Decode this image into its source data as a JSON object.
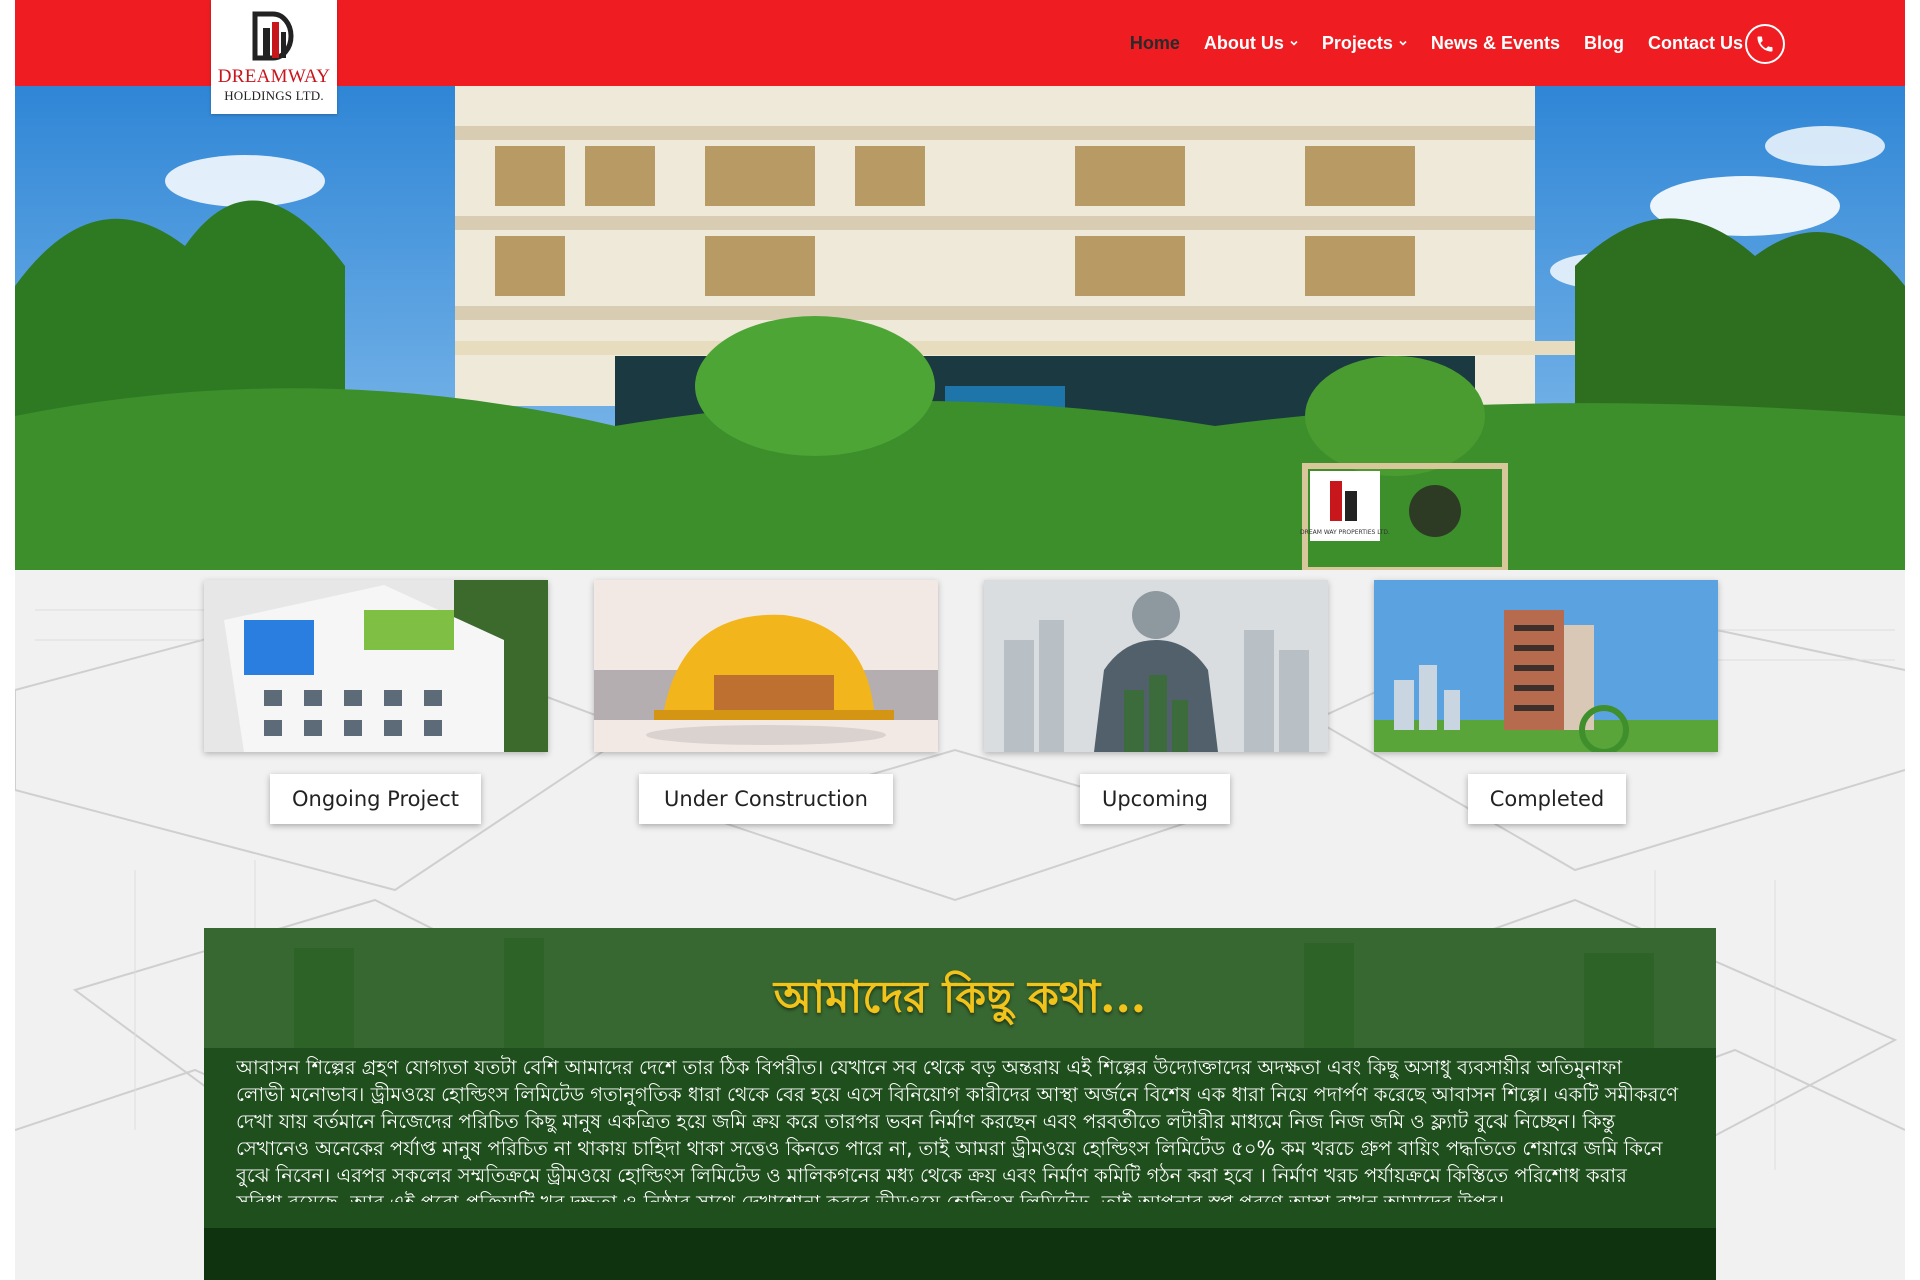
{
  "brand": {
    "name_line1": "DREAMWAY",
    "name_line2": "HOLDINGS LTD.",
    "primary_color": "#ef1d22"
  },
  "nav": {
    "items": [
      {
        "label": "Home",
        "active": true,
        "has_dropdown": false
      },
      {
        "label": "About Us",
        "active": false,
        "has_dropdown": true
      },
      {
        "label": "Projects",
        "active": false,
        "has_dropdown": true
      },
      {
        "label": "News & Events",
        "active": false,
        "has_dropdown": false
      },
      {
        "label": "Blog",
        "active": false,
        "has_dropdown": false
      },
      {
        "label": "Contact Us",
        "active": false,
        "has_dropdown": false
      }
    ],
    "phone_icon": "phone-icon"
  },
  "hero": {
    "image": "building-render",
    "sign": "DREAM WAY PROPERTIES LTD."
  },
  "categories": [
    {
      "label": "Ongoing Project",
      "image": "rooftop-pool-building"
    },
    {
      "label": "Under Construction",
      "image": "hard-hat-city-sunset"
    },
    {
      "label": "Upcoming",
      "image": "engineer-city-double-exposure"
    },
    {
      "label": "Completed",
      "image": "tower-with-city-skyline"
    }
  ],
  "about": {
    "title": "আমাদের কিছু কথা...",
    "paragraph_lines": [
      "আবাসন শিল্পের গ্রহণ যোগ্যতা যতটা বেশি আমাদের দেশে তার ঠিক বিপরীত। যেখানে সব থেকে বড় অন্তরায় এই শিল্পের উদ্যোক্তাদের অদক্ষতা এবং কিছু অসাধু ব্যবসায়ীর অতিমুনাফা",
      "লোভী মনোভাব। ড্রীমওয়ে হোল্ডিংস লিমিটেড গতানুগতিক ধারা থেকে বের হয়ে এসে বিনিয়োগ কারীদের আস্থা অর্জনে বিশেষ এক ধারা নিয়ে পদার্পণ করেছে আবাসন শিল্পে। একটি সমীকরণে",
      "দেখা যায় বর্তমানে নিজেদের পরিচিত কিছু মানুষ একত্রিত হয়ে জমি ক্রয় করে তারপর ভবন নির্মাণ করছেন এবং পরবর্তীতে লটারীর মাধ্যমে নিজ নিজ জমি ও ফ্ল্যাট বুঝে নিচ্ছেন। কিন্তু",
      "সেখানেও অনেকের পর্যাপ্ত মানুষ পরিচিত না থাকায় চাহিদা থাকা সত্তেও কিনতে পারে না, তাই আমরা ড্রীমওয়ে হোল্ডিংস লিমিটেড ৫০% কম খরচে গ্রুপ বায়িং পদ্ধতিতে শেয়ারে জমি কিনে",
      "বুঝে নিবেন। এরপর সকলের সম্মতিক্রমে ড্রীমওয়ে হোল্ডিংস লিমিটেড ও মালিকগনের মধ্য থেকে ক্রয় এবং নির্মাণ কমিটি গঠন করা হবে । নির্মাণ খরচ পর্যায়ক্রমে কিস্তিতে পরিশোধ করার",
      "সুবিধা রয়েছে, আর এই পুরো প্রক্রিয়াটি খুব দক্ষতা ও নিষ্ঠার সাথে দেখাশোনা করবে ড্রীমওয়ে হোল্ডিংস লিমিটেড, তাই আপনার স্বপ্ন পূরণে আস্থা রাখুন আমাদের উপর।"
    ],
    "title_color": "#f2c31a"
  }
}
